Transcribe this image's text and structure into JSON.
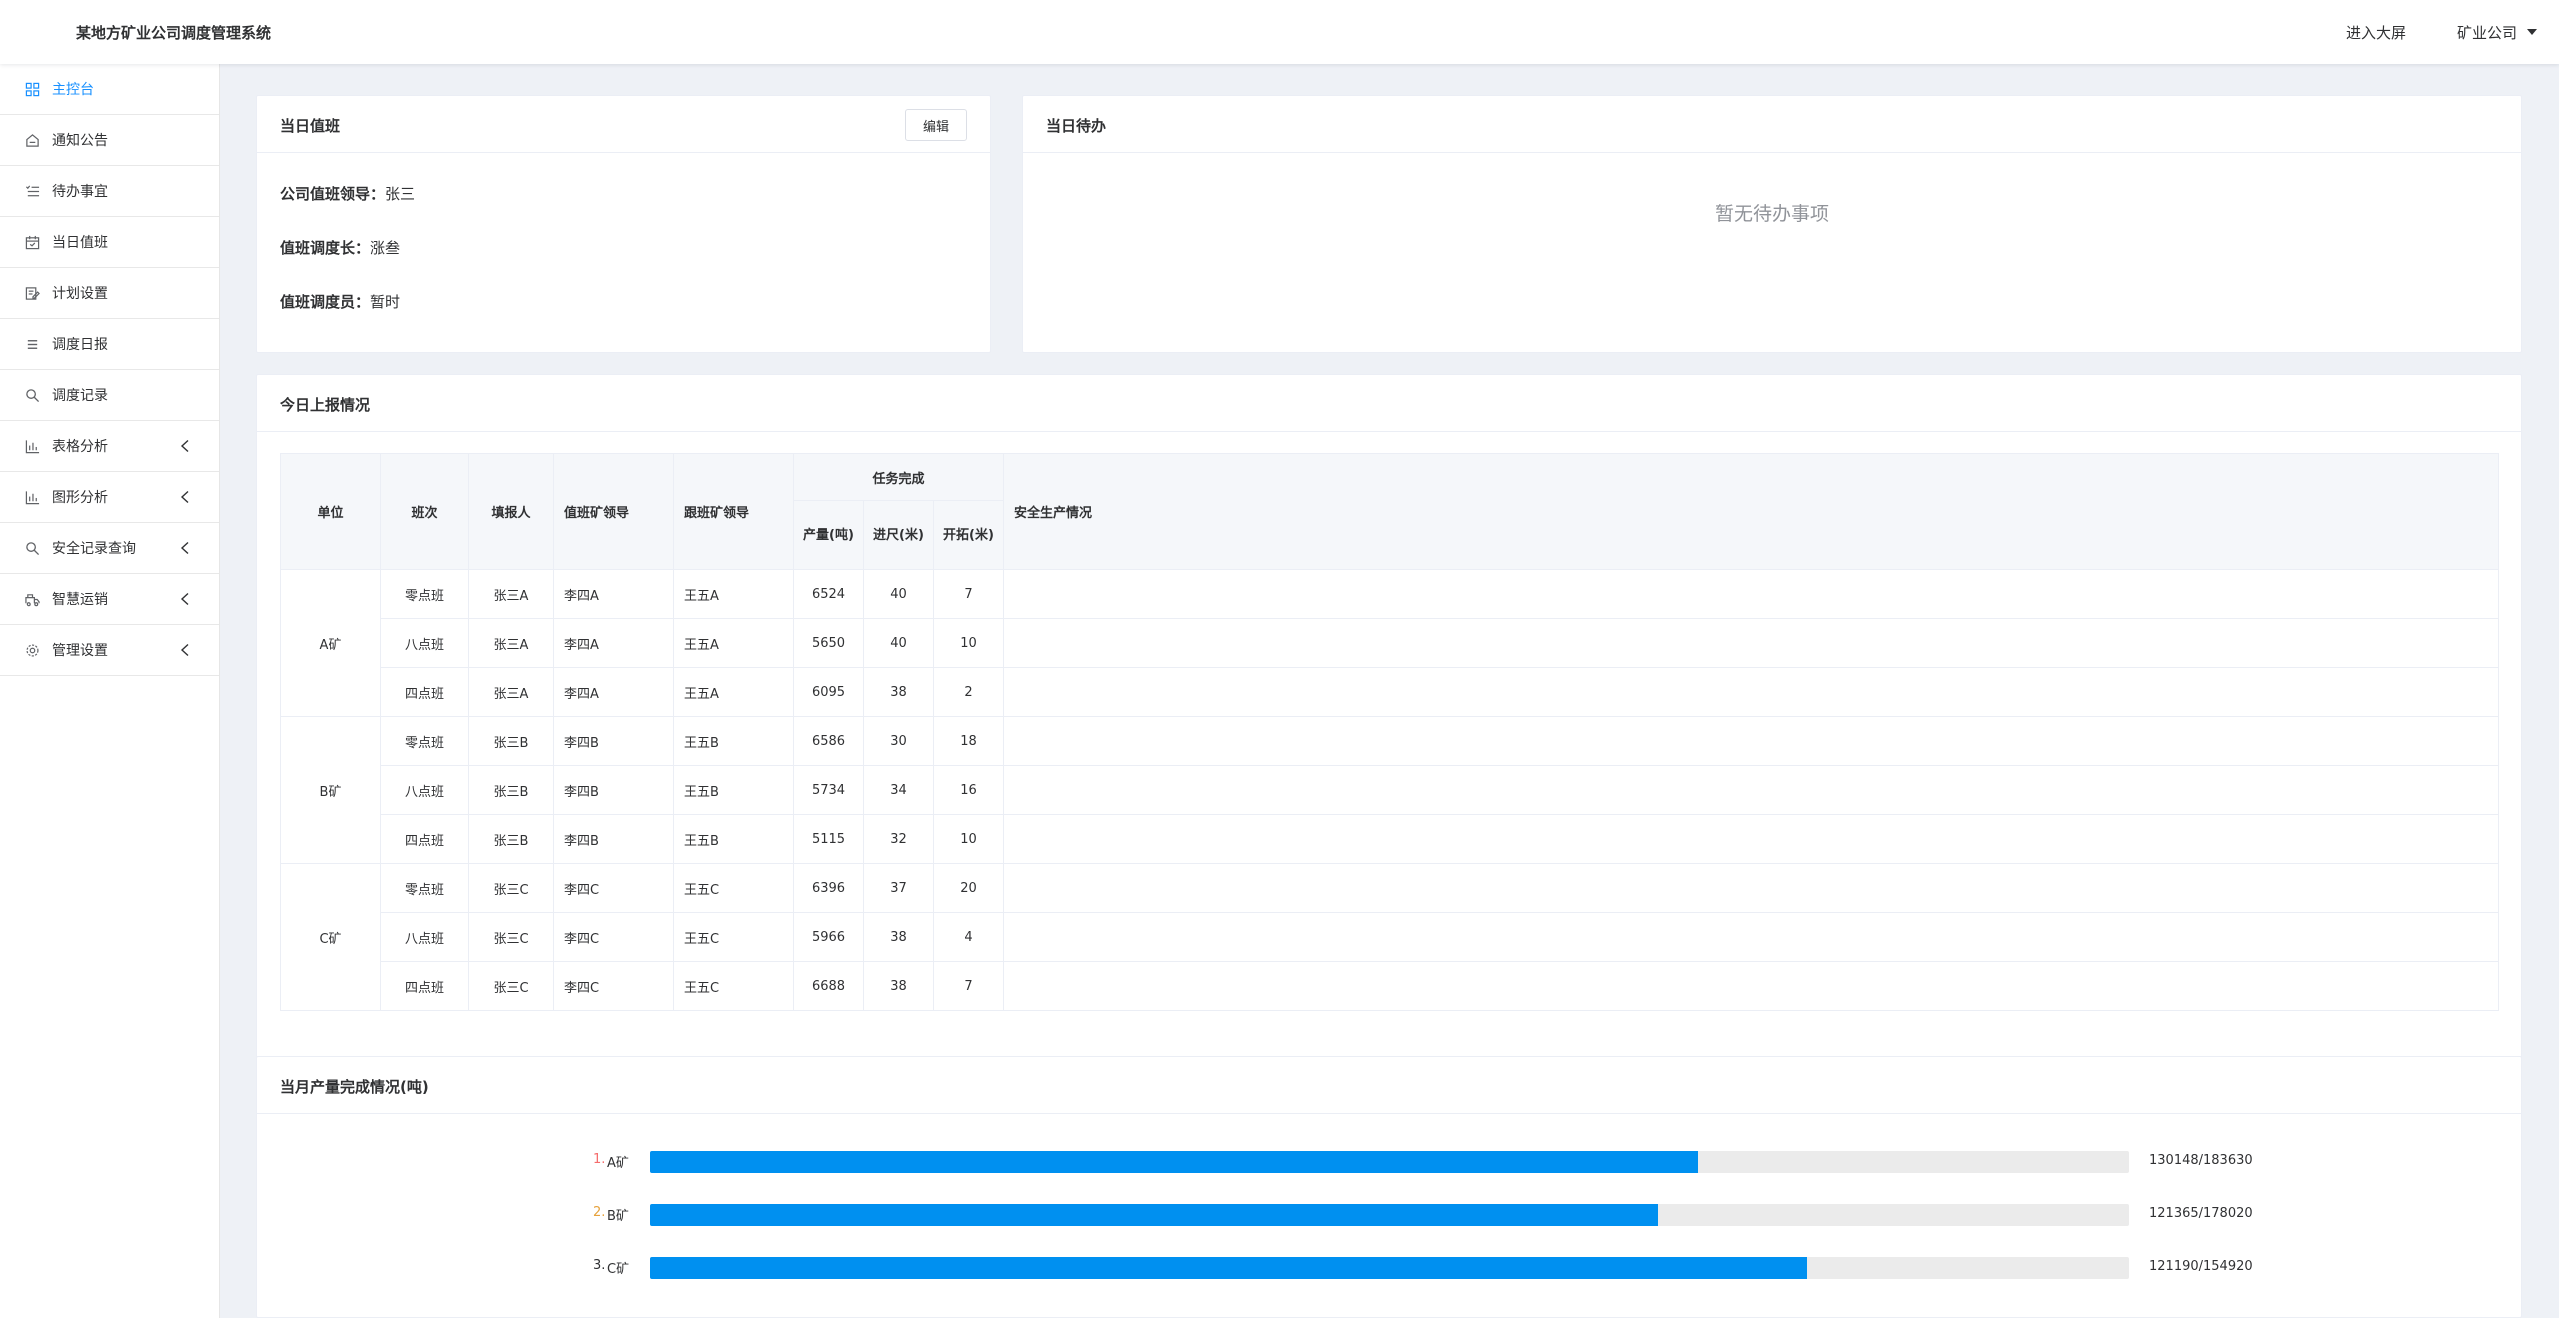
{
  "header": {
    "app_title": "某地方矿业公司调度管理系统",
    "enter_screen": "进入大屏",
    "company": "矿业公司"
  },
  "sidebar": {
    "items": [
      {
        "label": "主控台",
        "icon": "dashboard-icon",
        "active": true,
        "expandable": false
      },
      {
        "label": "通知公告",
        "icon": "notice-icon",
        "active": false,
        "expandable": false
      },
      {
        "label": "待办事宜",
        "icon": "list-icon",
        "active": false,
        "expandable": false
      },
      {
        "label": "当日值班",
        "icon": "calendar-icon",
        "active": false,
        "expandable": false
      },
      {
        "label": "计划设置",
        "icon": "plan-icon",
        "active": false,
        "expandable": false
      },
      {
        "label": "调度日报",
        "icon": "report-icon",
        "active": false,
        "expandable": false
      },
      {
        "label": "调度记录",
        "icon": "search-icon",
        "active": false,
        "expandable": false
      },
      {
        "label": "表格分析",
        "icon": "bar-chart-icon",
        "active": false,
        "expandable": true
      },
      {
        "label": "图形分析",
        "icon": "bar-chart-icon",
        "active": false,
        "expandable": true
      },
      {
        "label": "安全记录查询",
        "icon": "search-icon",
        "active": false,
        "expandable": true
      },
      {
        "label": "智慧运销",
        "icon": "truck-icon",
        "active": false,
        "expandable": true
      },
      {
        "label": "管理设置",
        "icon": "gear-icon",
        "active": false,
        "expandable": true
      }
    ]
  },
  "duty": {
    "title": "当日值班",
    "edit_label": "编辑",
    "leader_label": "公司值班领导：",
    "leader_value": "张三",
    "chief_label": "值班调度长：",
    "chief_value": "涨叁",
    "staff_label": "值班调度员：",
    "staff_value": "暂时"
  },
  "todo": {
    "title": "当日待办",
    "empty_text": "暂无待办事项"
  },
  "report": {
    "title": "今日上报情况",
    "headers": {
      "unit": "单位",
      "shift": "班次",
      "reporter": "填报人",
      "duty_leader": "值班矿领导",
      "follow_leader": "跟班矿领导",
      "task_group": "任务完成",
      "output": "产量(吨)",
      "footage": "进尺(米)",
      "develop": "开拓(米)",
      "safety": "安全生产情况"
    },
    "groups": [
      {
        "unit": "A矿",
        "rows": [
          {
            "shift": "零点班",
            "reporter": "张三A",
            "duty_leader": "李四A",
            "follow_leader": "王五A",
            "output": "6524",
            "footage": "40",
            "develop": "7",
            "safety": ""
          },
          {
            "shift": "八点班",
            "reporter": "张三A",
            "duty_leader": "李四A",
            "follow_leader": "王五A",
            "output": "5650",
            "footage": "40",
            "develop": "10",
            "safety": ""
          },
          {
            "shift": "四点班",
            "reporter": "张三A",
            "duty_leader": "李四A",
            "follow_leader": "王五A",
            "output": "6095",
            "footage": "38",
            "develop": "2",
            "safety": ""
          }
        ]
      },
      {
        "unit": "B矿",
        "rows": [
          {
            "shift": "零点班",
            "reporter": "张三B",
            "duty_leader": "李四B",
            "follow_leader": "王五B",
            "output": "6586",
            "footage": "30",
            "develop": "18",
            "safety": ""
          },
          {
            "shift": "八点班",
            "reporter": "张三B",
            "duty_leader": "李四B",
            "follow_leader": "王五B",
            "output": "5734",
            "footage": "34",
            "develop": "16",
            "safety": ""
          },
          {
            "shift": "四点班",
            "reporter": "张三B",
            "duty_leader": "李四B",
            "follow_leader": "王五B",
            "output": "5115",
            "footage": "32",
            "develop": "10",
            "safety": ""
          }
        ]
      },
      {
        "unit": "C矿",
        "rows": [
          {
            "shift": "零点班",
            "reporter": "张三C",
            "duty_leader": "李四C",
            "follow_leader": "王五C",
            "output": "6396",
            "footage": "37",
            "develop": "20",
            "safety": ""
          },
          {
            "shift": "八点班",
            "reporter": "张三C",
            "duty_leader": "李四C",
            "follow_leader": "王五C",
            "output": "5966",
            "footage": "38",
            "develop": "4",
            "safety": ""
          },
          {
            "shift": "四点班",
            "reporter": "张三C",
            "duty_leader": "李四C",
            "follow_leader": "王五C",
            "output": "6688",
            "footage": "38",
            "develop": "7",
            "safety": ""
          }
        ]
      }
    ]
  },
  "monthly": {
    "title": "当月产量完成情况(吨)",
    "bar_color": "#0090f0",
    "track_color": "#ebebeb",
    "items": [
      {
        "rank": "1.",
        "rank_color": "#f56c6c",
        "name": "A矿",
        "done": 130148,
        "plan": 183630,
        "value_text": "130148/183630"
      },
      {
        "rank": "2.",
        "rank_color": "#e6a23c",
        "name": "B矿",
        "done": 121365,
        "plan": 178020,
        "value_text": "121365/178020"
      },
      {
        "rank": "3.",
        "rank_color": "#303133",
        "name": "C矿",
        "done": 121190,
        "plan": 154920,
        "value_text": "121190/154920"
      }
    ]
  }
}
